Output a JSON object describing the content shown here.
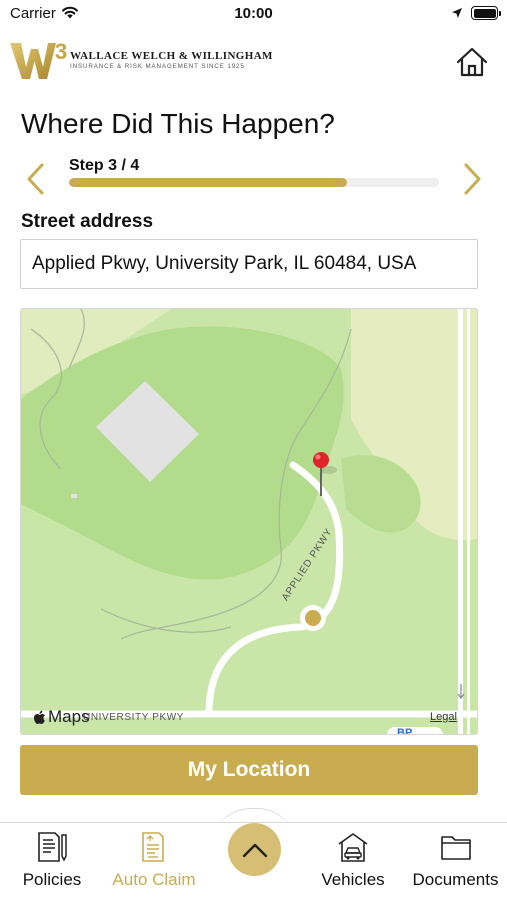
{
  "status_bar": {
    "carrier": "Carrier",
    "time": "10:00"
  },
  "header": {
    "logo_mark": "W3",
    "logo_name": "WALLACE WELCH & WILLINGHAM",
    "logo_tagline": "INSURANCE & RISK MANAGEMENT SINCE 1925",
    "home_icon": "home-icon"
  },
  "page": {
    "title": "Where Did This Happen?"
  },
  "stepper": {
    "label": "Step 3 / 4",
    "progress_fraction": 0.75,
    "prev_icon": "chevron-left-icon",
    "next_icon": "chevron-right-icon"
  },
  "form": {
    "street_label": "Street address",
    "street_value": "Applied Pkwy, University Park, IL 60484, USA"
  },
  "map": {
    "brand": "Maps",
    "legal": "Legal",
    "road_label_1": "UNIVERSITY PKWY",
    "road_label_2": "APPLIED PKWY",
    "poi_badge": "BP"
  },
  "actions": {
    "my_location": "My Location"
  },
  "tabs": [
    {
      "label": "Policies",
      "icon": "policy-document-icon",
      "active": false
    },
    {
      "label": "Auto Claim",
      "icon": "auto-claim-icon",
      "active": true
    },
    {
      "label": "Vehicles",
      "icon": "vehicle-garage-icon",
      "active": false
    },
    {
      "label": "Documents",
      "icon": "folder-icon",
      "active": false
    }
  ],
  "colors": {
    "accent": "#c9ac4f",
    "map_green": "#c9e6a8",
    "pin_red": "#e0242b"
  }
}
